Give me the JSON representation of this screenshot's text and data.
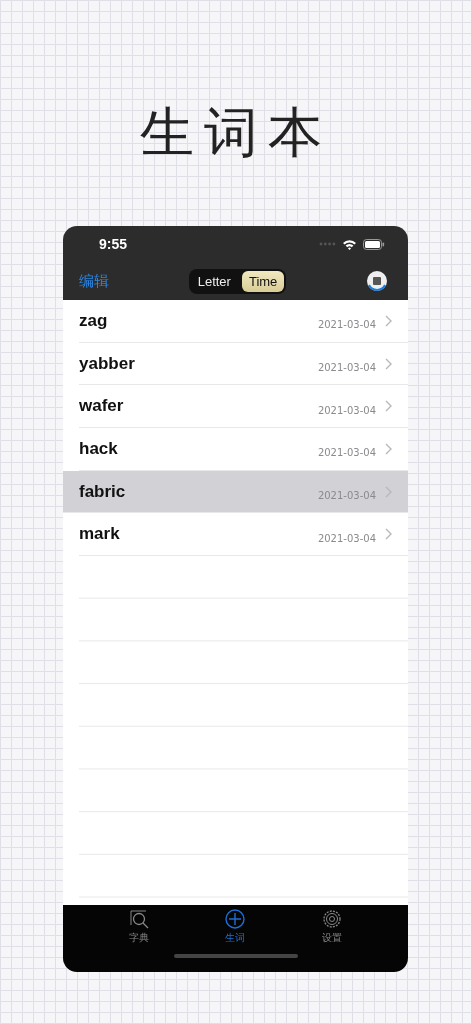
{
  "headline": "生词本",
  "status_bar": {
    "time": "9:55"
  },
  "nav": {
    "edit": "编辑",
    "segments": [
      {
        "label": "Letter",
        "selected": false
      },
      {
        "label": "Time",
        "selected": true
      }
    ]
  },
  "rows": [
    {
      "word": "zag",
      "date": "2021-03-04",
      "selected": false
    },
    {
      "word": "yabber",
      "date": "2021-03-04",
      "selected": false
    },
    {
      "word": "wafer",
      "date": "2021-03-04",
      "selected": false
    },
    {
      "word": "hack",
      "date": "2021-03-04",
      "selected": false
    },
    {
      "word": "fabric",
      "date": "2021-03-04",
      "selected": true
    },
    {
      "word": "mark",
      "date": "2021-03-04",
      "selected": false
    }
  ],
  "tabs": [
    {
      "label": "字典",
      "kind": "search",
      "selected": false
    },
    {
      "label": "生词",
      "kind": "add",
      "selected": true
    },
    {
      "label": "设置",
      "kind": "settings",
      "selected": false
    }
  ]
}
